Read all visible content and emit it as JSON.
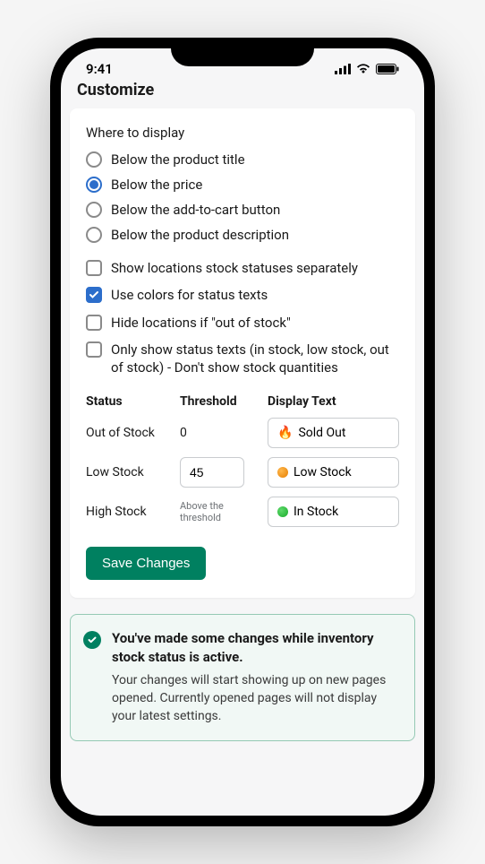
{
  "statusBar": {
    "time": "9:41"
  },
  "pageTitle": "Customize",
  "whereToDisplay": {
    "title": "Where to display",
    "options": [
      {
        "label": "Below the product title",
        "selected": false
      },
      {
        "label": "Below the price",
        "selected": true
      },
      {
        "label": "Below the add-to-cart button",
        "selected": false
      },
      {
        "label": "Below the product description",
        "selected": false
      }
    ]
  },
  "checkboxes": [
    {
      "label": "Show locations stock statuses separately",
      "checked": false
    },
    {
      "label": "Use colors for status texts",
      "checked": true
    },
    {
      "label": "Hide locations if \"out of stock\"",
      "checked": false
    },
    {
      "label": "Only show status texts (in stock, low stock, out of stock) - Don't show stock quantities",
      "checked": false
    }
  ],
  "statusTable": {
    "headers": {
      "status": "Status",
      "threshold": "Threshold",
      "displayText": "Display Text"
    },
    "rows": {
      "outOfStock": {
        "status": "Out of Stock",
        "threshold": "0",
        "displayText": "Sold Out",
        "icon": "fire"
      },
      "lowStock": {
        "status": "Low Stock",
        "threshold": "45",
        "displayText": "Low Stock",
        "icon": "orange"
      },
      "highStock": {
        "status": "High Stock",
        "threshold": "Above the threshold",
        "displayText": "In Stock",
        "icon": "green"
      }
    }
  },
  "saveButton": "Save Changes",
  "banner": {
    "title": "You've made some changes while inventory stock status is active.",
    "body": "Your changes will start showing up on new pages opened. Currently opened pages will not display your latest settings."
  }
}
